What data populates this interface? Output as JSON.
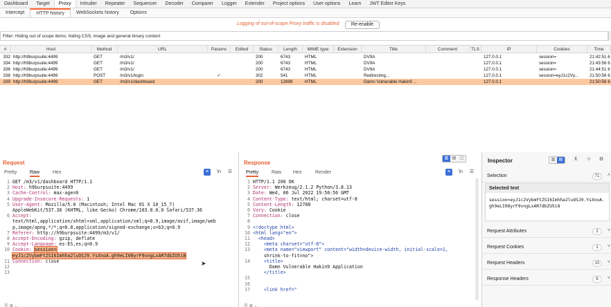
{
  "top_tabs": [
    "Dashboard",
    "Target",
    "Proxy",
    "Intruder",
    "Repeater",
    "Sequencer",
    "Decoder",
    "Comparer",
    "Logger",
    "Extender",
    "Project options",
    "User options",
    "Learn",
    "JWT Editor Keys"
  ],
  "top_active": "Proxy",
  "sub_tabs": [
    "Intercept",
    "HTTP history",
    "WebSockets history",
    "Options"
  ],
  "sub_active": "HTTP history",
  "info": {
    "message": "Logging of out-of-scope Proxy traffic is disabled",
    "button": "Re-enable"
  },
  "filter": {
    "text": "Filter: Hiding out of scope items;  hiding CSS, image and general binary content"
  },
  "table": {
    "columns": [
      "#",
      "Host",
      "Method",
      "URL",
      "Params",
      "Edited",
      "Status",
      "Length",
      "MIME type",
      "Extension",
      "Title",
      "Comment",
      "TLS",
      "IP",
      "Cookies",
      "Time"
    ],
    "rows": [
      {
        "num": "332",
        "host": "http://h9burpsuite:4499",
        "method": "GET",
        "url": "/m3/v1/",
        "params": "",
        "edited": "",
        "status": "200",
        "length": "6743",
        "mime": "HTML",
        "ext": "",
        "title": "DV9A",
        "comment": "",
        "tls": "",
        "ip": "127.0.0.1",
        "cookies": "session=",
        "time": "21:42:51 6 J"
      },
      {
        "num": "334",
        "host": "http://h9burpsuite:4499",
        "method": "GET",
        "url": "/m3/v1/",
        "params": "",
        "edited": "",
        "status": "200",
        "length": "6743",
        "mime": "HTML",
        "ext": "",
        "title": "DV9A",
        "comment": "",
        "tls": "",
        "ip": "127.0.0.1",
        "cookies": "session=",
        "time": "21:43:56 6 J"
      },
      {
        "num": "336",
        "host": "http://h9burpsuite:4499",
        "method": "GET",
        "url": "/m3/v1/",
        "params": "",
        "edited": "",
        "status": "200",
        "length": "6743",
        "mime": "HTML",
        "ext": "",
        "title": "DV9A",
        "comment": "",
        "tls": "",
        "ip": "127.0.0.1",
        "cookies": "session=",
        "time": "21:44:51 6 J"
      },
      {
        "num": "338",
        "host": "http://h9burpsuite:4499",
        "method": "POST",
        "url": "/m3/v1/login",
        "params": "✓",
        "edited": "",
        "status": "302",
        "length": "541",
        "mime": "HTML",
        "ext": "",
        "title": "Redirecting...",
        "comment": "",
        "tls": "",
        "ip": "127.0.0.1",
        "cookies": "session=eyJ1c2Vy...",
        "time": "21:50:56 6 J"
      },
      {
        "num": "339",
        "host": "http://h9burpsuite:4499",
        "method": "GET",
        "url": "/m3/v1/dashboard",
        "params": "",
        "edited": "",
        "status": "200",
        "length": "12898",
        "mime": "HTML",
        "ext": "",
        "title": "Damn Vulnerable Hakin9 ...",
        "comment": "",
        "tls": "",
        "ip": "127.0.0.1",
        "cookies": "",
        "time": "21:50:56 6 J"
      }
    ]
  },
  "request": {
    "title": "Request",
    "tabs": [
      "Pretty",
      "Raw",
      "Hex"
    ],
    "active_tab": "Raw",
    "newline_label": "\\n",
    "lines": [
      {
        "n": "1",
        "k": "",
        "v": "GET /m3/v1/dashboard HTTP/1.1"
      },
      {
        "n": "2",
        "k": "Host:",
        "v": " h9burpsuite:4499"
      },
      {
        "n": "3",
        "k": "Cache-Control:",
        "v": " max-age=0"
      },
      {
        "n": "4",
        "k": "Upgrade-Insecure-Requests:",
        "v": " 1"
      },
      {
        "n": "5",
        "k": "User-Agent:",
        "v": " Mozilla/5.0 (Macintosh; Intel Mac OS X 10_15_7)"
      },
      {
        "n": "",
        "k": "",
        "v": "AppleWebKit/537.36 (KHTML, like Gecko) Chrome/103.0.0.0 Safari/537.36"
      },
      {
        "n": "6",
        "k": "Accept:",
        "v": ""
      },
      {
        "n": "",
        "k": "",
        "v": "text/html,application/xhtml+xml,application/xml;q=0.9,image/avif,image/web"
      },
      {
        "n": "",
        "k": "",
        "v": "p,image/apng,*/*;q=0.8,application/signed-exchange;v=b3;q=0.9"
      },
      {
        "n": "7",
        "k": "Referer:",
        "v": " http://h9burpsuite:4499/m3/v1/"
      },
      {
        "n": "8",
        "k": "Accept-Encoding:",
        "v": " gzip, deflate"
      },
      {
        "n": "9",
        "k": "Accept-Language:",
        "v": " es-ES,es;q=0.9"
      },
      {
        "n": "10",
        "k": "Cookie:",
        "v": " ",
        "hl": "session="
      },
      {
        "n": "",
        "k": "",
        "v": "",
        "hl": "eyJ1c2VybmFtZSI6Imhha2luOSJ9.YsXnoA.gh9eLI08yrF9vngLxAR7dbZU5i8"
      },
      {
        "n": "11",
        "k": "Connection:",
        "v": " close"
      },
      {
        "n": "12",
        "k": "",
        "v": ""
      },
      {
        "n": "13",
        "k": "",
        "v": ""
      }
    ]
  },
  "response": {
    "title": "Response",
    "tabs": [
      "Pretty",
      "Raw",
      "Hex",
      "Render"
    ],
    "active_tab": "Pretty",
    "newline_label": "\\n",
    "lines": [
      {
        "n": "1",
        "h": "",
        "v": "HTTP/1.1 200 OK"
      },
      {
        "n": "2",
        "h": "Server:",
        "v": " Werkzeug/2.1.2 Python/3.8.13"
      },
      {
        "n": "3",
        "h": "Date:",
        "v": " Wed, 06 Jul 2022 19:50:56 GMT"
      },
      {
        "n": "4",
        "h": "Content-Type:",
        "v": " text/html; charset=utf-8"
      },
      {
        "n": "5",
        "h": "Content-Length:",
        "v": " 12708"
      },
      {
        "n": "6",
        "h": "Vary:",
        "v": " Cookie"
      },
      {
        "n": "7",
        "h": "Connection:",
        "v": " close"
      },
      {
        "n": "8",
        "h": "",
        "v": ""
      },
      {
        "n": "9",
        "h": "",
        "v": "<!doctype html>"
      },
      {
        "n": "10",
        "h": "",
        "v": "<html lang=\"en\">"
      },
      {
        "n": "11",
        "h": "",
        "v": "  <head>"
      },
      {
        "n": "12",
        "h": "",
        "v": "    <meta charset=\"utf-8\">"
      },
      {
        "n": "13",
        "h": "",
        "v": "    <meta name=\"viewport\" content=\"width=device-width, initial-scale=1,"
      },
      {
        "n": "",
        "h": "",
        "v": "    shrink-to-fit=no\">"
      },
      {
        "n": "14",
        "h": "",
        "v": "    <title>"
      },
      {
        "n": "",
        "h": "",
        "v": "      Damn Vulnerable Hakin9 Application"
      },
      {
        "n": "",
        "h": "",
        "v": "    </title>"
      },
      {
        "n": "15",
        "h": "",
        "v": ""
      },
      {
        "n": "16",
        "h": "",
        "v": ""
      },
      {
        "n": "17",
        "h": "",
        "v": "    <link href=\""
      }
    ]
  },
  "inspector": {
    "title": "Inspector",
    "selection_label": "Selection",
    "selection_count": "71",
    "selected_text_label": "Selected text",
    "selected_text_value": "session=eyJ1c2VybmFtZSI6Imhha2luOSJ9.YsXnoA.gh9eLI08yrF9vngLxAR7dbZU5i8",
    "sections": [
      {
        "label": "Request Attributes",
        "count": "2"
      },
      {
        "label": "Request Cookies",
        "count": "1"
      },
      {
        "label": "Request Headers",
        "count": "10"
      },
      {
        "label": "Response Headers",
        "count": "6"
      }
    ]
  }
}
